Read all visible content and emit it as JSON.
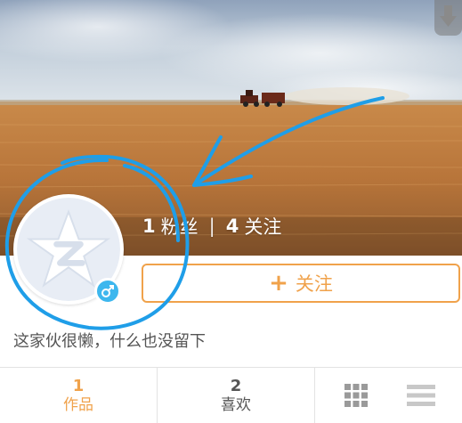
{
  "profile": {
    "fans_count": "1",
    "fans_label": "粉丝",
    "separator": "|",
    "following_count": "4",
    "following_label": "关注",
    "follow_button_label": "关注",
    "follow_button_plus": "+",
    "bio": "这家伙很懒，什么也没留下"
  },
  "tabs": [
    {
      "count": "1",
      "label": "作品"
    },
    {
      "count": "2",
      "label": "喜欢"
    }
  ],
  "icons": {
    "pull_handle": "arrow-down-icon",
    "avatar": "qq-logo-icon",
    "gender": "male-icon",
    "grid_view": "grid-view-icon",
    "list_view": "list-view-icon"
  },
  "colors": {
    "accent": "#f0a24b",
    "gender_badge": "#3db7ee",
    "annotation": "#1f9ee8"
  }
}
